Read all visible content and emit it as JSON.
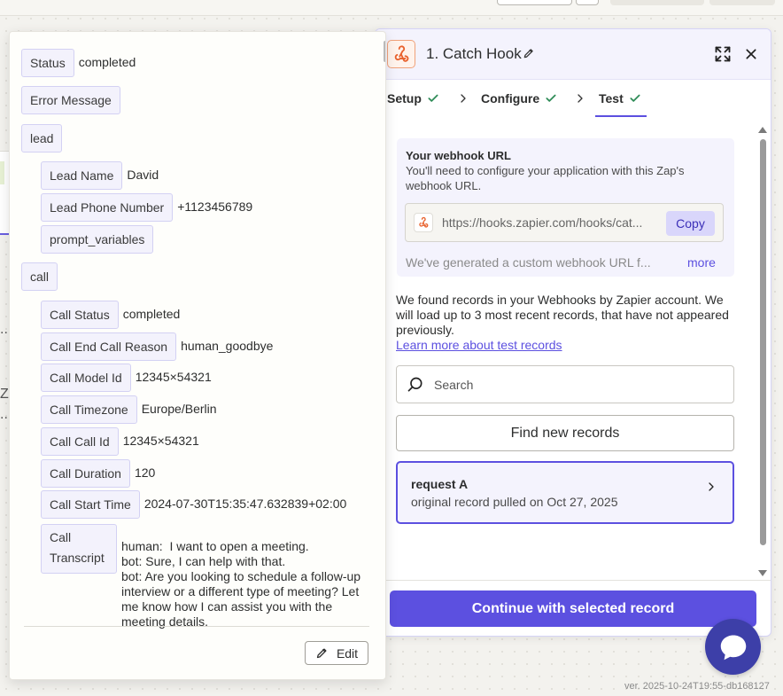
{
  "background": {
    "fragments": [
      "...",
      "Z",
      "..."
    ]
  },
  "panel": {
    "title": "1. Catch Hook",
    "tabs": [
      {
        "label": "Setup"
      },
      {
        "label": "Configure"
      },
      {
        "label": "Test"
      }
    ],
    "webhook": {
      "title": "Your webhook URL",
      "description": "You'll need to configure your application with this Zap's webhook URL.",
      "url": "https://hooks.zapier.com/hooks/cat...",
      "copy_label": "Copy",
      "generated_text": "We've generated a custom webhook URL f...",
      "more_label": "more"
    },
    "found_text": "We found records in your Webhooks by Zapier account. We will load up to 3 most recent records, that have not appeared previously.",
    "learn_link": "Learn more about test records",
    "search": {
      "placeholder": "Search",
      "value": ""
    },
    "find_button": "Find new records",
    "record": {
      "title": "request A",
      "subtitle": "original record pulled on Oct 27, 2025"
    },
    "continue_button": "Continue with selected record"
  },
  "record_detail": {
    "status_key": "Status",
    "status_value": "completed",
    "error_key": "Error Message",
    "lead_key": "lead",
    "lead_name_key": "Lead Name",
    "lead_name_value": "David",
    "lead_phone_key": "Lead Phone Number",
    "lead_phone_value": "+1123456789",
    "prompt_key": "prompt_variables",
    "call_key": "call",
    "call_status_key": "Call Status",
    "call_status_value": "completed",
    "call_end_key": "Call End Call Reason",
    "call_end_value": "human_goodbye",
    "call_model_key": "Call Model Id",
    "call_model_value": "12345×54321",
    "call_tz_key": "Call Timezone",
    "call_tz_value": "Europe/Berlin",
    "call_id_key": "Call Call Id",
    "call_id_value": "12345×54321",
    "call_duration_key": "Call Duration",
    "call_duration_value": "120",
    "call_start_key": "Call Start Time",
    "call_start_value": "2024-07-30T15:35:47.632839+02:00",
    "call_transcript_key": "Call Transcript",
    "call_transcript_value": "human:  I want to open a meeting.\nbot: Sure, I can help with that.\nbot: Are you looking to schedule a follow-up interview or a different type of meeting? Let me know how I can assist you with the meeting details.",
    "edit_label": "Edit"
  },
  "version": "ver. 2025-10-24T19:55-db168127",
  "colors": {
    "accent": "#5c50e0",
    "accent_soft": "#f4f3fd",
    "chat_fab": "#3d3fa8",
    "check_green": "#2e8b57",
    "webhook_orange": "#e8612c"
  }
}
